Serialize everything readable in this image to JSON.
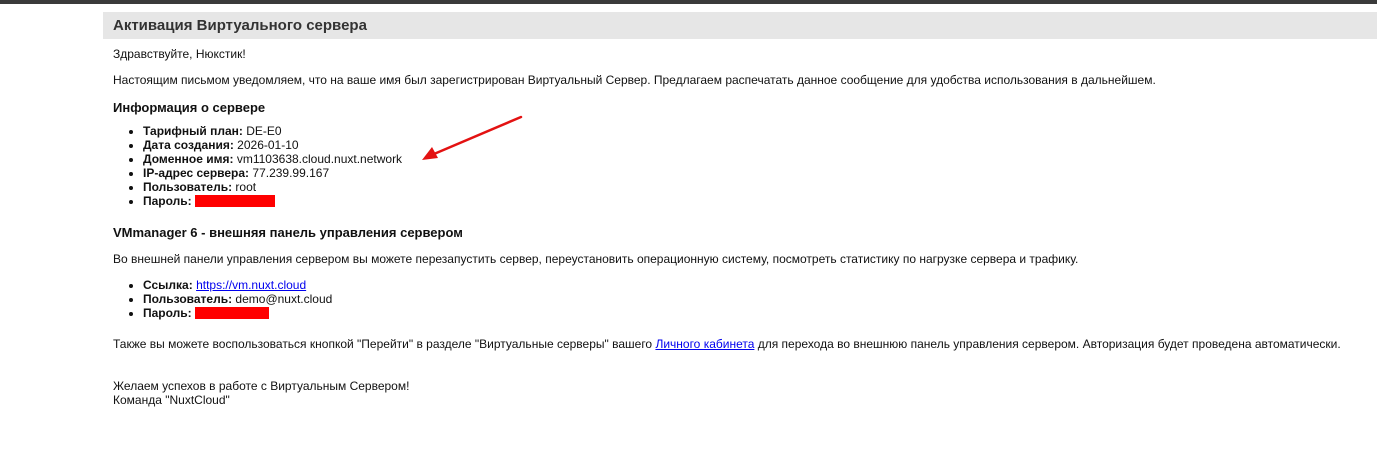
{
  "title": "Активация Виртуального сервера",
  "greeting": "Здравствуйте, Нюкстик!",
  "intro": "Настоящим письмом уведомляем, что на ваше имя был зарегистрирован Виртуальный Сервер. Предлагаем распечатать данное сообщение для удобства использования в дальнейшем.",
  "server_info": {
    "heading": "Информация о сервере",
    "items": [
      {
        "label": "Тарифный план:",
        "value": " DE-E0"
      },
      {
        "label": "Дата создания:",
        "value": " 2026-01-10"
      },
      {
        "label": "Доменное имя:",
        "value": " vm1103638.cloud.nuxt.network"
      },
      {
        "label": "IP-адрес сервера:",
        "value": " 77.239.99.167"
      },
      {
        "label": "Пользователь:",
        "value": " root"
      },
      {
        "label": "Пароль:",
        "value": ""
      }
    ]
  },
  "panel": {
    "heading": "VMmanager 6 - внешняя панель управления сервером",
    "description": "Во внешней панели управления сервером вы можете перезапустить сервер, переустановить операционную систему, посмотреть статистику по нагрузке сервера и трафику.",
    "link_label": "Ссылка:",
    "link_text": "https://vm.nuxt.cloud",
    "user_label": "Пользователь:",
    "user_value": " demo@nuxt.cloud",
    "password_label": "Пароль:"
  },
  "also": {
    "before": "Также вы можете воспользоваться кнопкой \"Перейти\" в разделе \"Виртуальные серверы\" вашего ",
    "link_text": "Личного кабинета",
    "after": " для перехода во внешнюю панель управления сервером. Авторизация будет проведена автоматически."
  },
  "closing": {
    "line1": "Желаем успехов в работе с Виртуальным Сервером!",
    "line2": "Команда \"NuxtCloud\""
  },
  "colors": {
    "redaction": "#ff0000",
    "arrow": "#e31212",
    "header_bg": "#e6e6e6",
    "link": "#0000ee"
  }
}
